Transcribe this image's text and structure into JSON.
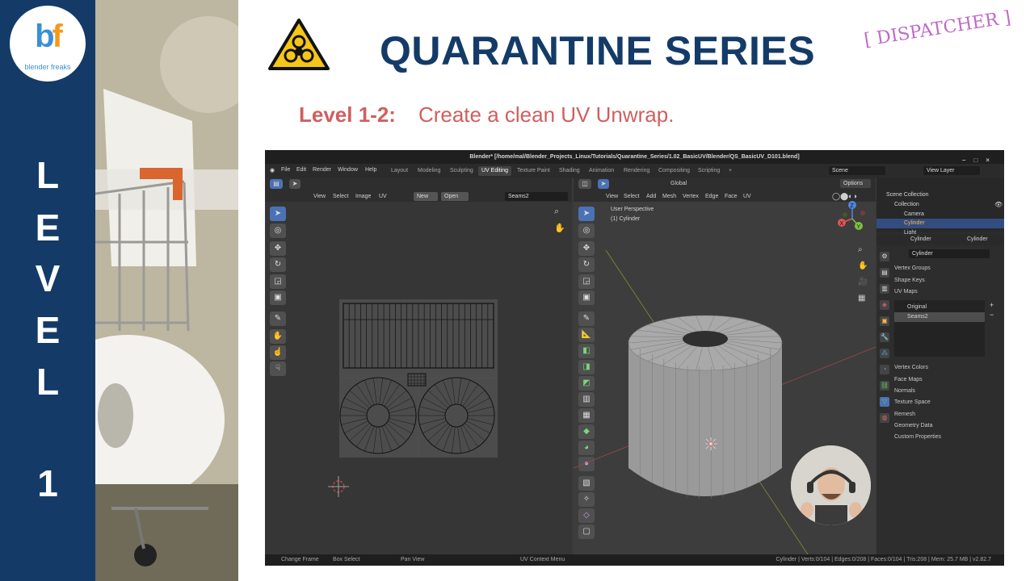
{
  "logo": {
    "mark": "bf",
    "caption": "blender freaks"
  },
  "sidebar": {
    "letters": [
      "L",
      "E",
      "V",
      "E",
      "L",
      "1"
    ]
  },
  "header": {
    "title": "QUARANTINE SERIES",
    "tag": "[ DISPATCHER ]",
    "level_label": "Level 1-2:",
    "level_desc": "Create a clean UV Unwrap."
  },
  "blender": {
    "window_title": "Blender* [/home/mal/Blender_Projects_Linux/Tutorials/Quarantine_Series/1.02_BasicUV/Blender/QS_BasicUV_D101.blend]",
    "menus": [
      "File",
      "Edit",
      "Render",
      "Window",
      "Help"
    ],
    "workspaces": [
      "Layout",
      "Modeling",
      "Sculpting",
      "UV Editing",
      "Texture Paint",
      "Shading",
      "Animation",
      "Rendering",
      "Compositing",
      "Scripting",
      "+"
    ],
    "active_workspace": "UV Editing",
    "scene": "Scene",
    "view_layer": "View Layer",
    "uv_editor": {
      "menus": [
        "View",
        "Select",
        "Image",
        "UV"
      ],
      "new": "New",
      "open": "Open",
      "uv_map": "Seams2"
    },
    "viewport": {
      "transform": "Global",
      "options": "Options",
      "menus": [
        "View",
        "Select",
        "Add",
        "Mesh",
        "Vertex",
        "Edge",
        "Face",
        "UV"
      ],
      "perspective": "User Perspective",
      "object": "(1) Cylinder",
      "axes": {
        "x": "X",
        "y": "Y",
        "z": "Z"
      }
    },
    "outliner": {
      "root": "Scene Collection",
      "items": [
        {
          "label": "Collection",
          "depth": 1
        },
        {
          "label": "Camera",
          "depth": 2
        },
        {
          "label": "Cylinder",
          "depth": 2,
          "selected": true
        },
        {
          "label": "Light",
          "depth": 2
        }
      ]
    },
    "properties": {
      "object_name": "Cylinder",
      "data_name": "Cylinder",
      "mesh_field": "Cylinder",
      "sections": [
        "Vertex Groups",
        "Shape Keys",
        "UV Maps"
      ],
      "uv_maps": [
        "Original",
        "Seams2"
      ],
      "sections2": [
        "Vertex Colors",
        "Face Maps",
        "Normals",
        "Texture Space",
        "Remesh",
        "Geometry Data",
        "Custom Properties"
      ]
    },
    "status": {
      "left": [
        "Change Frame",
        "Box Select",
        "Pan View",
        "UV Context Menu"
      ],
      "stats": "Cylinder | Verts:0/104 | Edges:0/208 | Faces:0/104 | Tris:208 | Mem: 25.7 MB | v2.82.7"
    }
  },
  "colors": {
    "navy": "#143b68",
    "accent_red": "#cf5f5f",
    "tag_purple": "#c06ac8",
    "blender_blue": "#4a72b4"
  }
}
